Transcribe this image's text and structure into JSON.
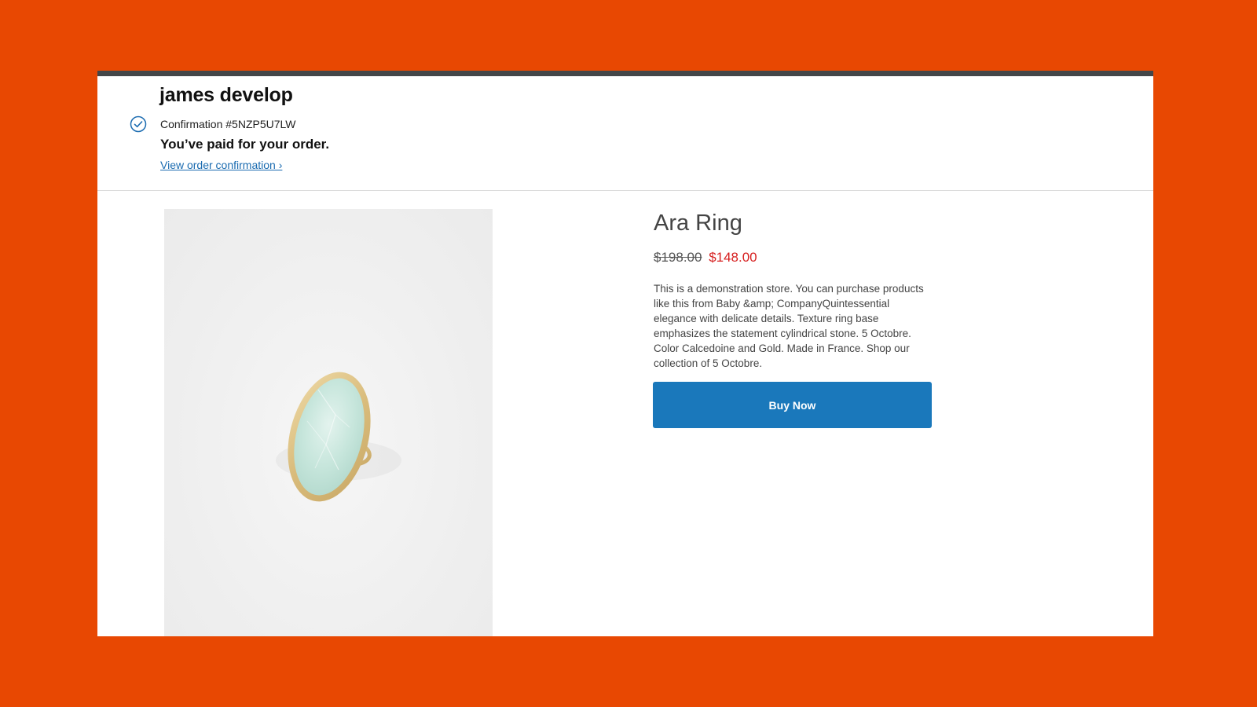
{
  "header": {
    "store_name": "james develop",
    "confirmation": "Confirmation #5NZP5U7LW",
    "paid_message": "You’ve paid for your order.",
    "view_link": "View order confirmation ›"
  },
  "product": {
    "title": "Ara Ring",
    "price_original": "$198.00",
    "price_sale": "$148.00",
    "description": "This is a demonstration store. You can purchase products like this from Baby &amp; CompanyQuintessential elegance with delicate details. Texture ring base emphasizes the statement cylindrical stone. 5 Octobre. Color Calcedoine and Gold. Made in France.  Shop our collection of 5 Octobre.",
    "buy_label": "Buy Now"
  },
  "colors": {
    "background": "#e84802",
    "accent": "#1a78bb",
    "sale_price": "#d61e1e",
    "link": "#1a6bb0"
  },
  "icons": {
    "confirmation": "check-circle-icon"
  }
}
